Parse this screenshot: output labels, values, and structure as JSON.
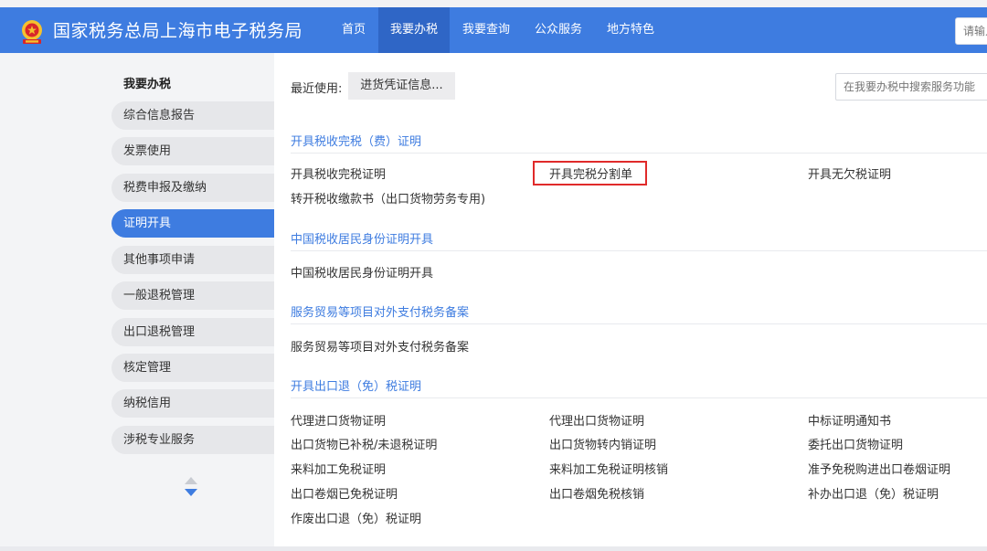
{
  "header": {
    "site_title": "国家税务总局上海市电子税务局",
    "nav": [
      "首页",
      "我要办税",
      "我要查询",
      "公众服务",
      "地方特色"
    ],
    "active_nav": "我要办税",
    "search_placeholder": "请输入",
    "brand_color": "#3e7ce0"
  },
  "sidebar": {
    "heading": "我要办税",
    "items": [
      "综合信息报告",
      "发票使用",
      "税费申报及缴纳",
      "证明开具",
      "其他事项申请",
      "一般退税管理",
      "出口退税管理",
      "核定管理",
      "纳税信用",
      "涉税专业服务"
    ],
    "active_item": "证明开具"
  },
  "main": {
    "recent_label": "最近使用:",
    "recent_button": "进货凭证信息...",
    "search_placeholder": "在我要办税中搜索服务功能",
    "sections": [
      {
        "title": "开具税收完税（费）证明",
        "links": [
          "开具税收完税证明",
          "开具完税分割单",
          "开具无欠税证明",
          "转开税收缴款书（出口货物劳务专用)"
        ]
      },
      {
        "title": "中国税收居民身份证明开具",
        "links": [
          "中国税收居民身份证明开具"
        ]
      },
      {
        "title": "服务贸易等项目对外支付税务备案",
        "links": [
          "服务贸易等项目对外支付税务备案"
        ]
      },
      {
        "title": "开具出口退（免）税证明",
        "links": [
          "代理进口货物证明",
          "代理出口货物证明",
          "中标证明通知书",
          "出口货物已补税/未退税证明",
          "出口货物转内销证明",
          "委托出口货物证明",
          "来料加工免税证明",
          "来料加工免税证明核销",
          "准予免税购进出口卷烟证明",
          "出口卷烟已免税证明",
          "出口卷烟免税核销",
          "补办出口退（免）税证明",
          "作废出口退（免）税证明"
        ]
      }
    ]
  }
}
